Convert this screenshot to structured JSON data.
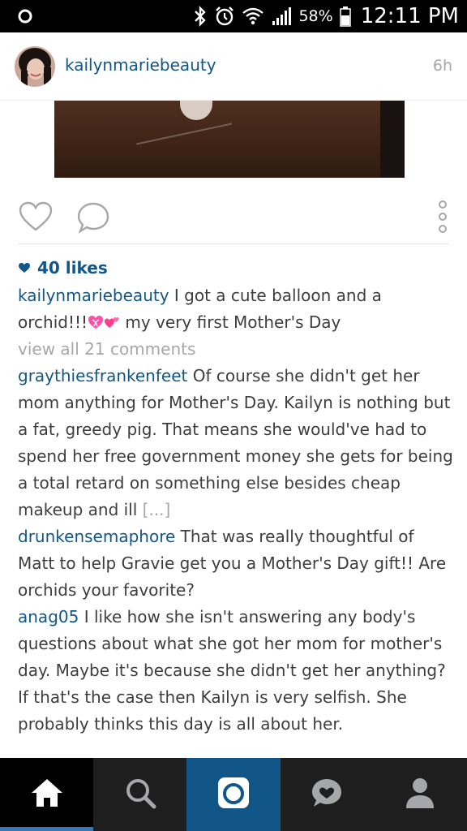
{
  "status_bar": {
    "battery_percent": "58%",
    "time": "12:11 PM"
  },
  "post": {
    "username": "kailynmariebeauty",
    "time_ago": "6h",
    "likes": "40 likes",
    "caption": {
      "username": "kailynmariebeauty",
      "text_before_emoji": " I got a cute balloon and a orchid!!!",
      "emojis": [
        "heart-with-ribbon",
        "two-hearts"
      ],
      "text_after_emoji": " my very first Mother's Day"
    },
    "view_all_comments": "view all 21 comments",
    "comments": [
      {
        "username": "graythiesfrankenfeet",
        "text": " Of course she didn't get her mom anything for Mother's Day. Kailyn is nothing but a fat,  greedy pig. That means she would've had to spend her free government money she gets for being a total retard on something else besides cheap makeup and ill ",
        "more": "[...]"
      },
      {
        "username": "drunkensemaphore",
        "text": " That was really thoughtful of Matt to help Gravie get you a Mother's Day gift!! Are orchids your favorite?"
      },
      {
        "username": "anag05",
        "text": " I like how she isn't answering any body's questions about what she got her mom for mother's day. Maybe it's because she didn't get her anything? If that's the case then Kailyn is very selfish. She probably thinks this day is all about her."
      }
    ]
  },
  "bottom_nav": {
    "items": [
      "home-icon",
      "search-icon",
      "camera-icon",
      "activity-icon",
      "profile-icon"
    ],
    "active": "home-icon"
  },
  "colors": {
    "username_blue": "#125688",
    "muted_gray": "#a5a7aa",
    "nav_bg": "#1e1e1e",
    "camera_tab": "#125688"
  }
}
